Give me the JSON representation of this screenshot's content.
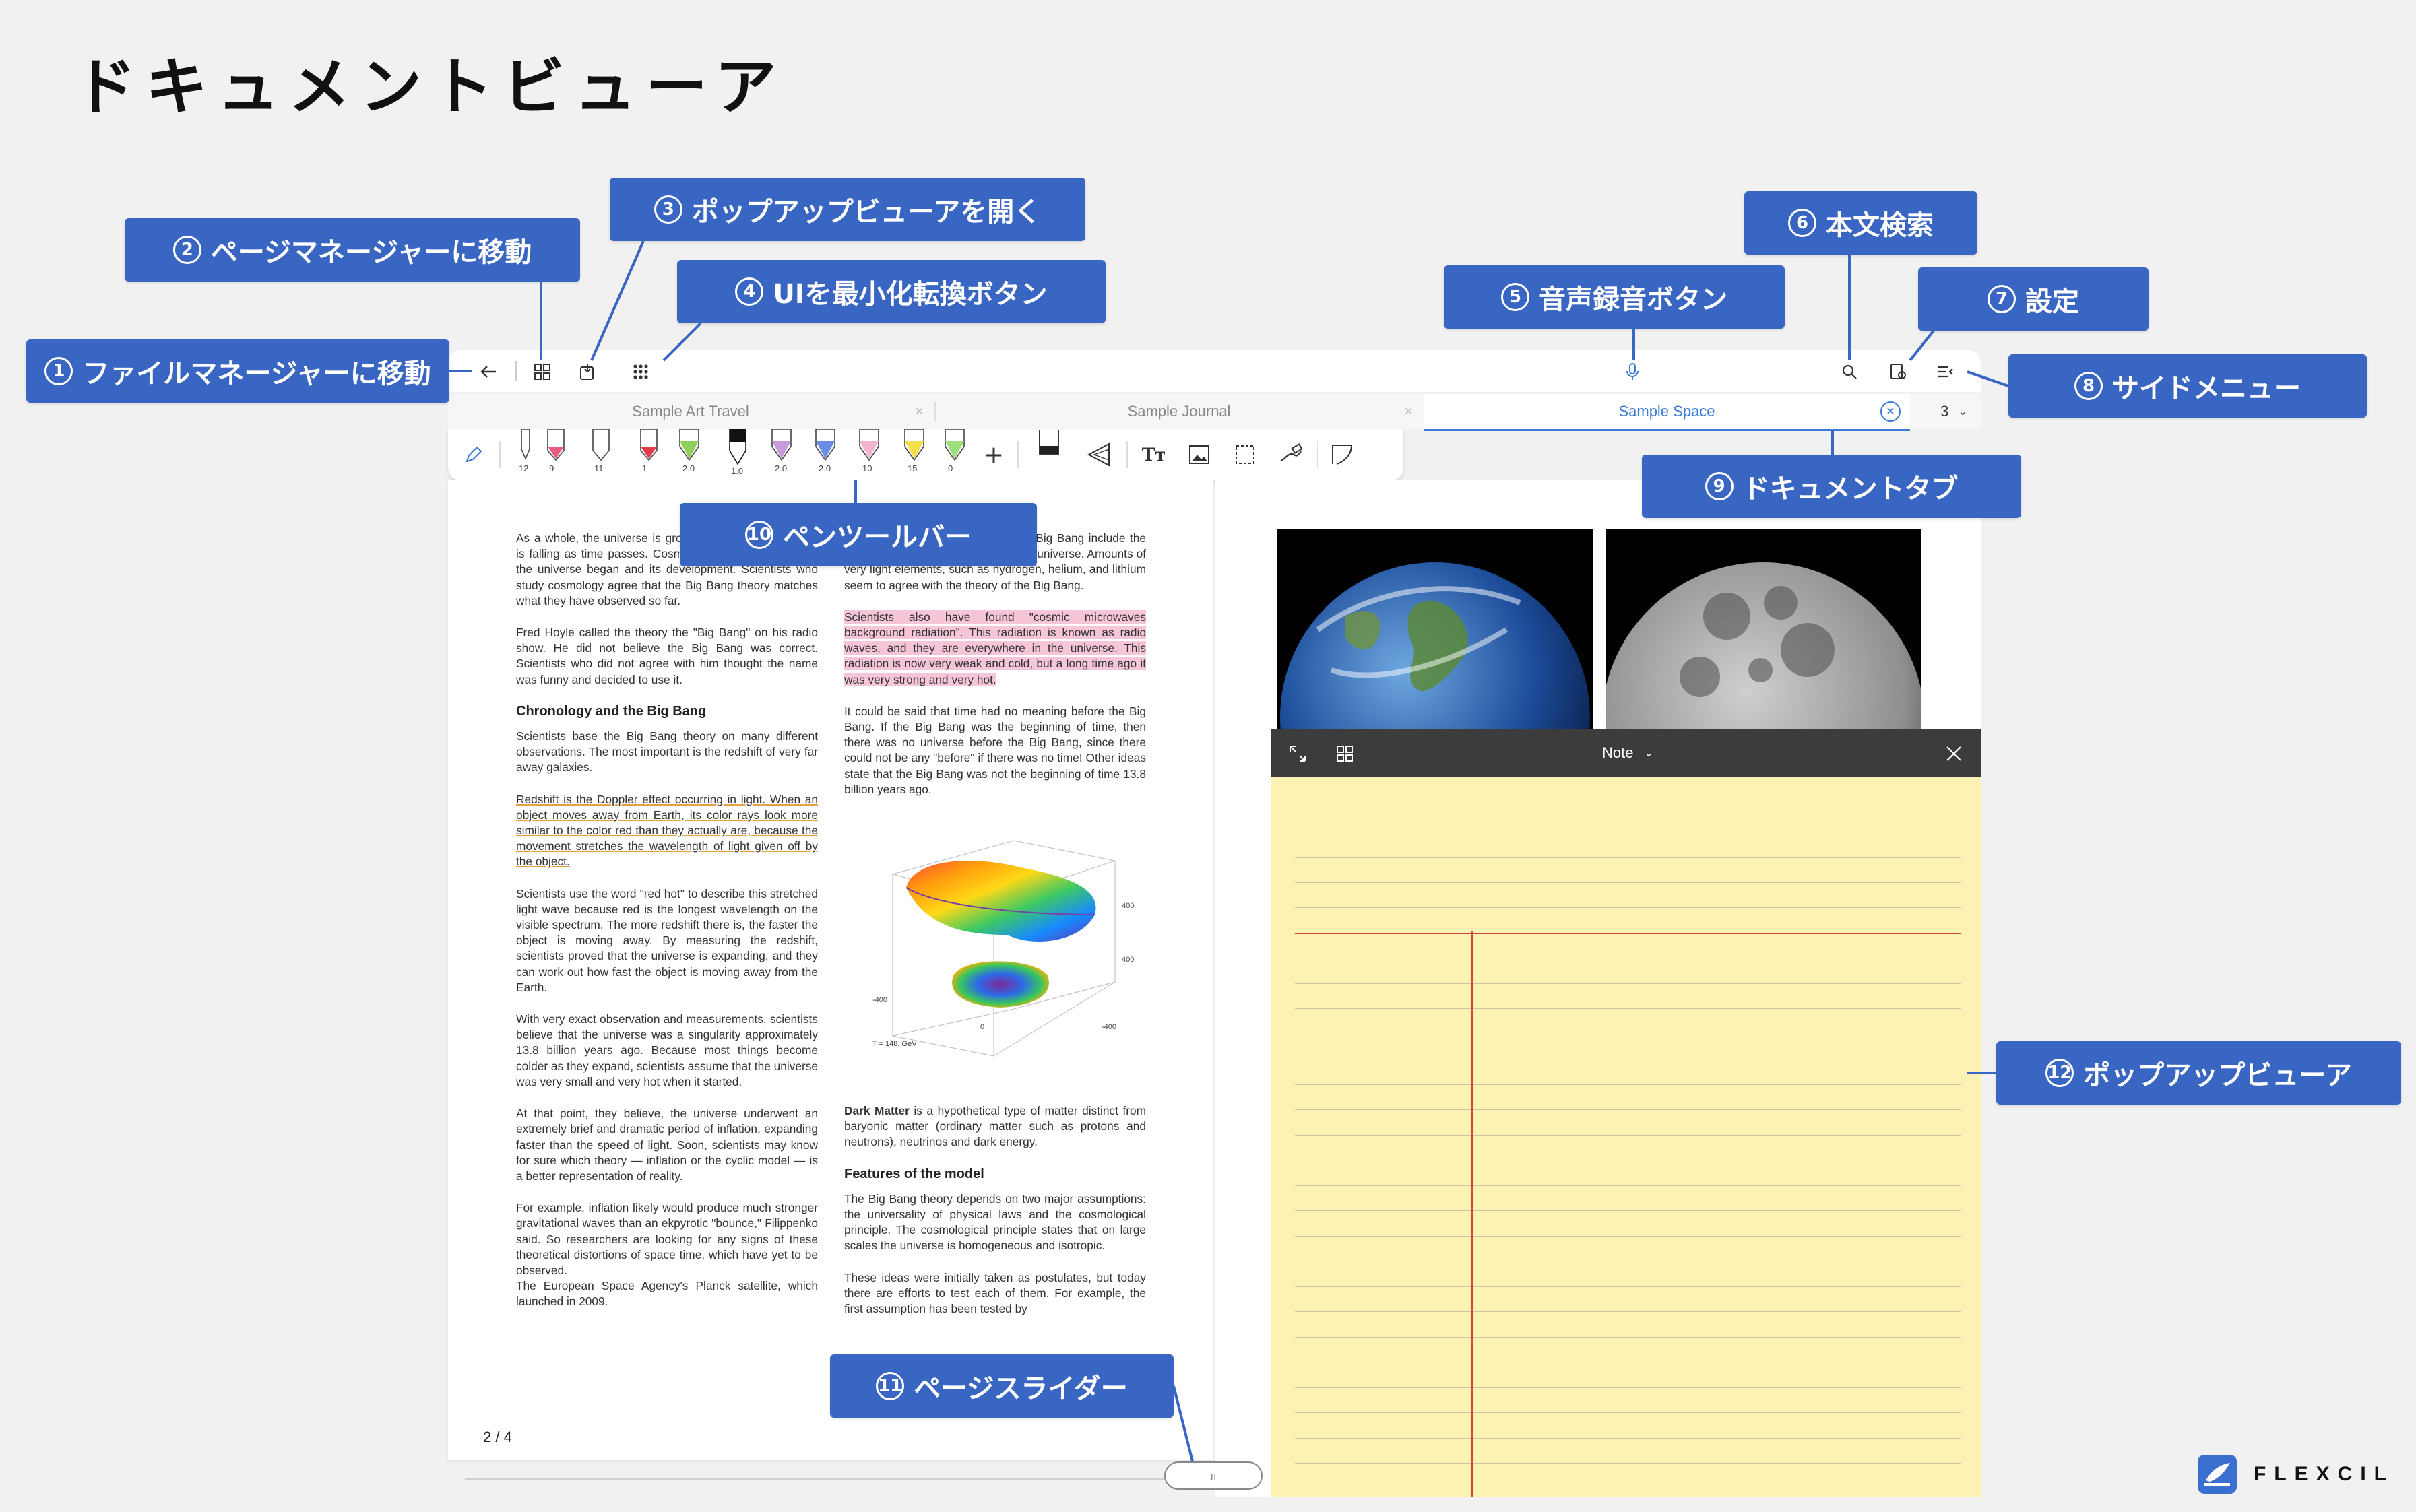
{
  "headline": "ドキュメントビューア",
  "callouts": {
    "c1": {
      "num": "1",
      "label": "ファイルマネージャーに移動"
    },
    "c2": {
      "num": "2",
      "label": "ページマネージャーに移動"
    },
    "c3": {
      "num": "3",
      "label": "ポップアップビューアを開く"
    },
    "c4": {
      "num": "4",
      "label": "UIを最小化転換ボタン"
    },
    "c5": {
      "num": "5",
      "label": "音声録音ボタン"
    },
    "c6": {
      "num": "6",
      "label": "本文検索"
    },
    "c7": {
      "num": "7",
      "label": "設定"
    },
    "c8": {
      "num": "8",
      "label": "サイドメニュー"
    },
    "c9": {
      "num": "9",
      "label": "ドキュメントタブ"
    },
    "c10": {
      "num": "10",
      "label": "ペンツールバー"
    },
    "c11": {
      "num": "11",
      "label": "ページスライダー"
    },
    "c12": {
      "num": "12",
      "label": "ポップアップビューア"
    }
  },
  "tabs": {
    "t1": "Sample Art Travel",
    "t2": "Sample Journal",
    "t3": "Sample Space",
    "count": "3"
  },
  "pens": {
    "p1": "12",
    "p2": "9",
    "p3": "11",
    "p4": "1",
    "p5": "2.0",
    "p6": "1.0",
    "p7": "2.0",
    "p8": "2.0",
    "p9": "10",
    "p10": "15",
    "p11": "0"
  },
  "left_col": {
    "p1": "As a whole, the universe is growing and the temperature is falling as time passes. Cosmology is the study of how the universe began and its development. Scientists who study cosmology agree that the Big Bang theory matches what they have observed so far.",
    "p2": "Fred Hoyle called the theory the \"Big Bang\" on his radio show. He did not believe the Big Bang was correct. Scientists who did not agree with him thought the name was funny and decided to use it.",
    "h1": "Chronology and the Big Bang",
    "p3": "Scientists base the Big Bang theory on many different observations. The most important is the redshift of very far away galaxies.",
    "p4": "Redshift is the Doppler effect occurring in light. When an object moves away from Earth, its color rays look more similar to the color red than they actually are, because the movement stretches the wavelength of light given off by the object.",
    "p5": "Scientists use the word \"red hot\" to describe this stretched light wave because red is the longest wavelength on the visible spectrum. The more redshift there is, the faster the object is moving away. By measuring the redshift, scientists proved that the universe is expanding, and they can work out how fast the object is moving away from the Earth.",
    "p6": "With very exact observation and measurements, scientists believe that the universe was a singularity approximately 13.8 billion years ago. Because most things become colder as they expand, scientists assume that the universe was very small and very hot when it started.",
    "p7": "At that point, they believe, the universe underwent an extremely brief and dramatic period of inflation, expanding faster than the speed of light. Soon, scientists may know for sure which theory — inflation or the cyclic model — is a better representation of reality.",
    "p8": "For example, inflation likely would produce much stronger gravitational waves than an ekpyrotic \"bounce,\" Filippenko said. So researchers are looking for any signs of these theoretical distortions of space time, which have yet to be observed.",
    "p9": "The European Space Agency's Planck satellite, which launched in 2009."
  },
  "right_col": {
    "p1": "Other observations that support the Big Bang include the amounts of chemical elements in the universe. Amounts of very light elements, such as hydrogen, helium, and lithium seem to agree with the theory of the Big Bang.",
    "p2": "Scientists also have found \"cosmic microwaves background radiation\". This radiation is known as radio waves, and they are everywhere in the universe. This radiation is now very weak and cold, but a long time ago it was very strong and very hot.",
    "p3": "It could be said that time had no meaning before the Big Bang. If the Big Bang was the beginning of time, then there was no universe before the Big Bang, since there could not be any \"before\" if there was no time! Other ideas state that the Big Bang was not the beginning of time 13.8 billion years ago.",
    "dm_bold": "Dark Matter",
    "dm_rest": " is a hypothetical type of matter distinct from baryonic matter (ordinary matter such as protons and neutrons), neutrinos and dark energy.",
    "h1": "Features of the model",
    "p4": "The Big Bang theory depends on two major assumptions: the universality of physical laws and the cosmological principle. The cosmological principle states that on large scales the universe is homogeneous and isotropic.",
    "p5": "These ideas were initially taken as postulates, but today there are efforts to test each of them. For example, the first assumption has been tested by"
  },
  "plot": {
    "caption": "T = 148.  GeV",
    "tick_400a": "400",
    "tick_n400a": "-400",
    "tick_400b": "400",
    "tick_n400b": "-400",
    "tick_0": "0"
  },
  "page_number": "2 / 4",
  "note_title": "Note",
  "brand": "FLEXCIL",
  "colors": {
    "callout": "#3966c3",
    "accent": "#3a7bd5",
    "note_paper": "#fdf1b3",
    "margin_line": "#d24a3e"
  }
}
